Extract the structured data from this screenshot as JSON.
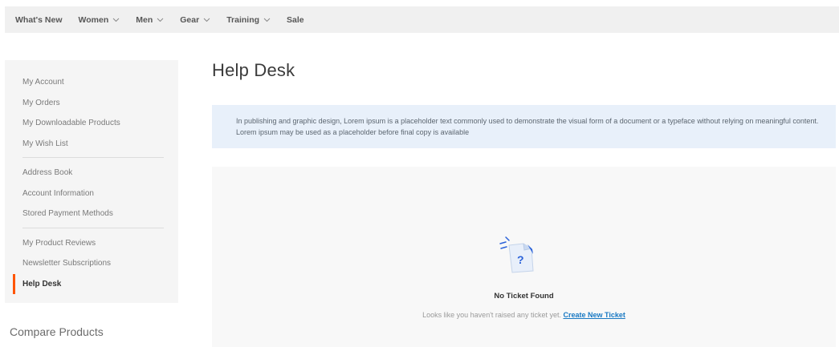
{
  "nav": {
    "items": [
      {
        "label": "What's New",
        "has_dropdown": false
      },
      {
        "label": "Women",
        "has_dropdown": true
      },
      {
        "label": "Men",
        "has_dropdown": true
      },
      {
        "label": "Gear",
        "has_dropdown": true
      },
      {
        "label": "Training",
        "has_dropdown": true
      },
      {
        "label": "Sale",
        "has_dropdown": false
      }
    ]
  },
  "sidebar": {
    "groups": [
      [
        "My Account",
        "My Orders",
        "My Downloadable Products",
        "My Wish List"
      ],
      [
        "Address Book",
        "Account Information",
        "Stored Payment Methods"
      ],
      [
        "My Product Reviews",
        "Newsletter Subscriptions",
        "Help Desk"
      ]
    ],
    "active": "Help Desk",
    "accent_color": "#ff5501"
  },
  "compare": {
    "title": "Compare Products"
  },
  "main": {
    "title": "Help Desk",
    "notice": "In publishing and graphic design, Lorem ipsum is a placeholder text commonly used to demonstrate the visual form of a document or a typeface without relying on meaningful content. Lorem ipsum may be used as a placeholder before final copy is available",
    "empty": {
      "icon": "ticket-question-icon",
      "title": "No Ticket Found",
      "subtitle": "Looks like you haven't raised any ticket yet.",
      "link": "Create New Ticket",
      "link_color": "#1979c3"
    }
  }
}
